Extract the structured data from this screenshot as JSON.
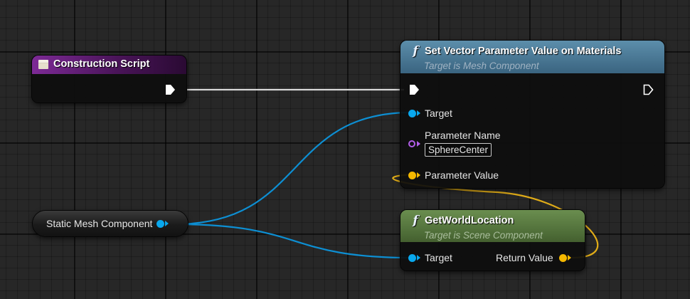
{
  "construction_node": {
    "title": "Construction Script",
    "header_color": "#5e1a72",
    "icon": "event-node-icon"
  },
  "set_vector_node": {
    "title": "Set Vector Parameter Value on Materials",
    "subtitle": "Target is Mesh Component",
    "header_color": "#3d6d8a",
    "icon": "function-icon",
    "pins": {
      "target": "Target",
      "parameter_name": "Parameter Name",
      "parameter_name_value": "SphereCenter",
      "parameter_value": "Parameter Value"
    }
  },
  "static_mesh_node": {
    "title": "Static Mesh Component"
  },
  "get_world_location_node": {
    "title": "GetWorldLocation",
    "subtitle": "Target is Scene Component",
    "header_color": "#4f6e3a",
    "icon": "function-icon",
    "pins": {
      "target": "Target",
      "return_value": "Return Value"
    }
  },
  "colors": {
    "object_pin": "#09a8ee",
    "vector_pin": "#f5b800",
    "name_pin": "#b25ee8",
    "exec_wire": "#e8e8e8"
  }
}
